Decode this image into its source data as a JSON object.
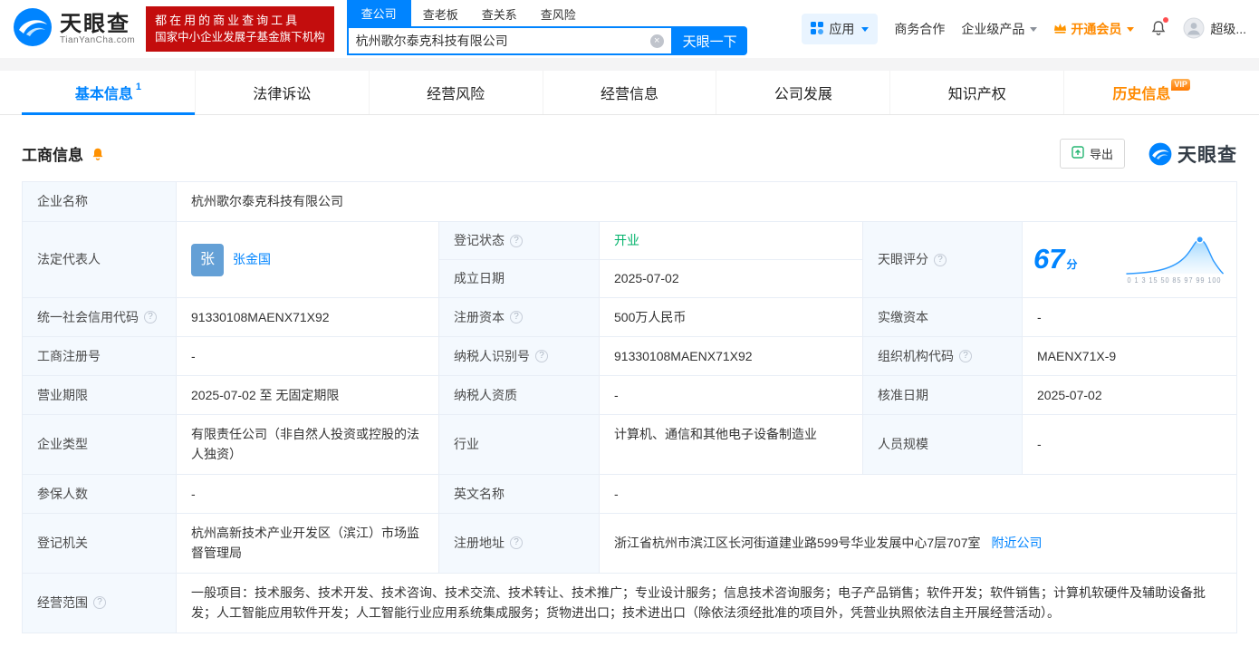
{
  "colors": {
    "brand_blue": "#0084ff",
    "banner_red": "#c30d0d",
    "vip_orange": "#ff8a00",
    "status_green": "#00b26a"
  },
  "header": {
    "brand": "天眼查",
    "brand_domain": "TianYanCha.com",
    "banner_line1": "都在用的商业查询工具",
    "banner_line2": "国家中小企业发展子基金旗下机构",
    "search_tabs": [
      "查公司",
      "查老板",
      "查关系",
      "查风险"
    ],
    "search_value": "杭州歌尔泰克科技有限公司",
    "search_button": "天眼一下",
    "nav_apps": "应用",
    "nav_cooperation": "商务合作",
    "nav_enterprise": "企业级产品",
    "nav_vip": "开通会员",
    "nav_user": "超级..."
  },
  "tabs": [
    {
      "label": "基本信息",
      "badge": "1"
    },
    {
      "label": "法律诉讼"
    },
    {
      "label": "经营风险"
    },
    {
      "label": "经营信息"
    },
    {
      "label": "公司发展"
    },
    {
      "label": "知识产权"
    },
    {
      "label": "历史信息",
      "vip": "VIP"
    }
  ],
  "section": {
    "title": "工商信息",
    "export": "导出",
    "watermark": "天眼查"
  },
  "info": {
    "company_name_label": "企业名称",
    "company_name": "杭州歌尔泰克科技有限公司",
    "legal_rep_label": "法定代表人",
    "legal_rep_avatar": "张",
    "legal_rep_name": "张金国",
    "reg_status_label": "登记状态",
    "reg_status": "开业",
    "establish_label": "成立日期",
    "establish_date": "2025-07-02",
    "score_label": "天眼评分",
    "score_value": "67",
    "score_unit": "分",
    "score_axis": "0 1 3 15 50 85 97 99 100",
    "credit_code_label": "统一社会信用代码",
    "credit_code": "91330108MAENX71X92",
    "reg_capital_label": "注册资本",
    "reg_capital": "500万人民币",
    "paid_capital_label": "实缴资本",
    "paid_capital": "-",
    "reg_number_label": "工商注册号",
    "reg_number": "-",
    "taxpayer_id_label": "纳税人识别号",
    "taxpayer_id": "91330108MAENX71X92",
    "org_code_label": "组织机构代码",
    "org_code": "MAENX71X-9",
    "business_term_label": "营业期限",
    "business_term": "2025-07-02 至 无固定期限",
    "taxpayer_quality_label": "纳税人资质",
    "taxpayer_quality": "-",
    "approval_date_label": "核准日期",
    "approval_date": "2025-07-02",
    "company_type_label": "企业类型",
    "company_type": "有限责任公司（非自然人投资或控股的法人独资）",
    "industry_label": "行业",
    "industry": "计算机、通信和其他电子设备制造业",
    "staff_size_label": "人员规模",
    "staff_size": "-",
    "insured_label": "参保人数",
    "insured": "-",
    "english_name_label": "英文名称",
    "english_name": "-",
    "reg_authority_label": "登记机关",
    "reg_authority": "杭州高新技术产业开发区（滨江）市场监督管理局",
    "reg_address_label": "注册地址",
    "reg_address": "浙江省杭州市滨江区长河街道建业路599号华业发展中心7层707室",
    "nearby_link": "附近公司",
    "business_scope_label": "经营范围",
    "business_scope": "一般项目：技术服务、技术开发、技术咨询、技术交流、技术转让、技术推广；专业设计服务；信息技术咨询服务；电子产品销售；软件开发；软件销售；计算机软硬件及辅助设备批发；人工智能应用软件开发；人工智能行业应用系统集成服务；货物进出口；技术进出口（除依法须经批准的项目外，凭营业执照依法自主开展经营活动）。"
  }
}
